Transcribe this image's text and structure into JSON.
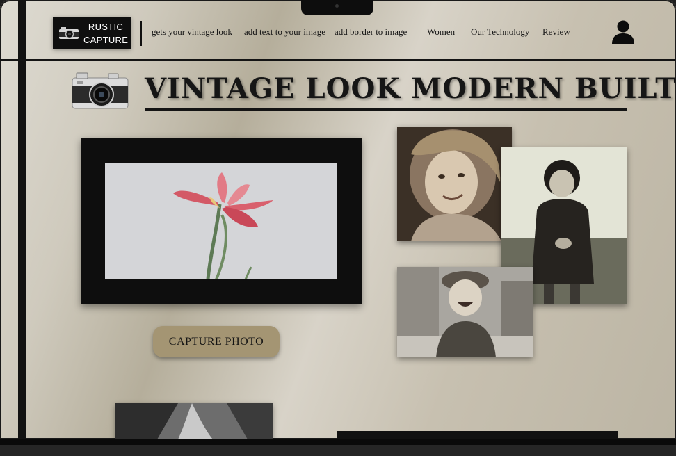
{
  "logo": {
    "line1": "RUSTIC",
    "line2": "CAPTURE"
  },
  "nav": {
    "items": [
      "gets your vintage look",
      "add text to your image",
      "add border to  image",
      "Women",
      "Our Technology",
      "Review"
    ]
  },
  "hero": {
    "headline": "VINTAGE LOOK MODERN BUILT"
  },
  "capture": {
    "button_label": "CAPTURE PHOTO"
  },
  "icons": {
    "logo": "camera-icon",
    "hero": "vintage-camera-icon",
    "account": "user-icon"
  },
  "colors": {
    "background": "#cfcabd",
    "dark": "#0f0f0f",
    "button": "#a49573"
  }
}
